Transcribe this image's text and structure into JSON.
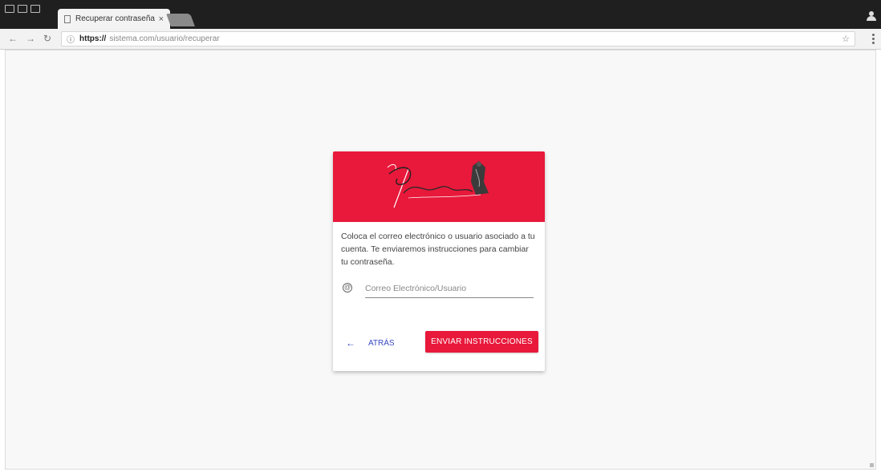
{
  "browser": {
    "tab_title": "Recuperar contraseña",
    "tab_close": "×",
    "url_scheme": "https://",
    "url_path": "sistema.com/usuario/recuperar"
  },
  "card": {
    "header_color": "#e8193b",
    "message": "Coloca el correo electrónico o usuario asociado a tu cuenta. Te enviaremos instrucciones para cambiar tu contraseña.",
    "email_placeholder": "Correo Electrónico/Usuario",
    "back_label": "ATRÁS",
    "send_label": "ENVIAR INSTRUCCIONES"
  },
  "icons": {
    "back": "arrow-left-icon",
    "email": "at-sign-icon",
    "lock": "secure-lock-icon",
    "star": "bookmark-star-icon"
  },
  "colors": {
    "accent": "#e8193b",
    "link": "#3a4bc2"
  }
}
